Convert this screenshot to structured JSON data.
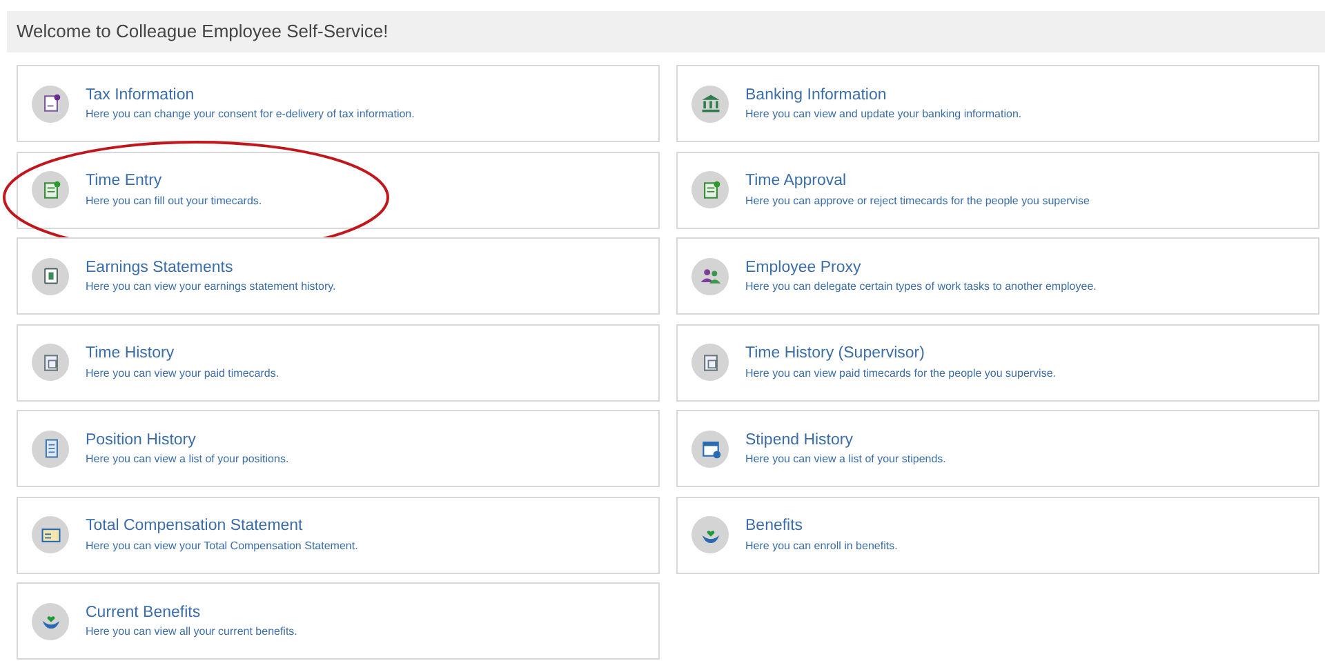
{
  "header": {
    "title": "Welcome to Colleague Employee Self-Service!"
  },
  "cards": [
    {
      "kind": "tax",
      "title": "Tax Information",
      "description": "Here you can change your consent for e-delivery of tax information.",
      "circled": false
    },
    {
      "kind": "bank",
      "title": "Banking Information",
      "description": "Here you can view and update your banking information.",
      "circled": false
    },
    {
      "kind": "timecard",
      "title": "Time Entry",
      "description": "Here you can fill out your timecards.",
      "circled": true
    },
    {
      "kind": "timecard",
      "title": "Time Approval",
      "description": "Here you can approve or reject timecards for the people you supervise",
      "circled": false
    },
    {
      "kind": "earnings",
      "title": "Earnings Statements",
      "description": "Here you can view your earnings statement history.",
      "circled": false
    },
    {
      "kind": "proxy",
      "title": "Employee Proxy",
      "description": "Here you can delegate certain types of work tasks to another employee.",
      "circled": false
    },
    {
      "kind": "history",
      "title": "Time History",
      "description": "Here you can view your paid timecards.",
      "circled": false
    },
    {
      "kind": "history",
      "title": "Time History (Supervisor)",
      "description": "Here you can view paid timecards for the people you supervise.",
      "circled": false
    },
    {
      "kind": "position",
      "title": "Position History",
      "description": "Here you can view a list of your positions.",
      "circled": false
    },
    {
      "kind": "stipend",
      "title": "Stipend History",
      "description": "Here you can view a list of your stipends.",
      "circled": false
    },
    {
      "kind": "compensation",
      "title": "Total Compensation Statement",
      "description": "Here you can view your Total Compensation Statement.",
      "circled": false
    },
    {
      "kind": "benefits",
      "title": "Benefits",
      "description": "Here you can enroll in benefits.",
      "circled": false
    },
    {
      "kind": "benefits",
      "title": "Current Benefits",
      "description": "Here you can view all your current benefits.",
      "circled": false
    }
  ]
}
